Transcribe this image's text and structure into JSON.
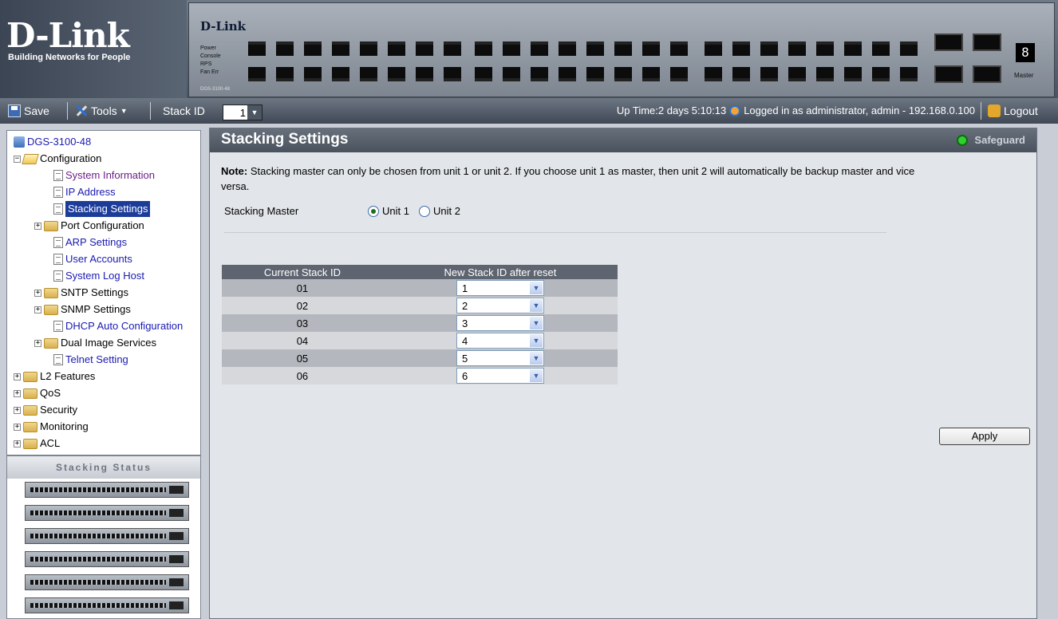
{
  "brand": {
    "logo": "D-Link",
    "tagline": "Building Networks for People",
    "device_brand": "D-Link",
    "device_leds": [
      "Power",
      "Console",
      "RPS",
      "Fan Err"
    ],
    "device_model": "DGS-3100-48",
    "segment_display": "8",
    "master_led": "Master"
  },
  "toolbar": {
    "save_label": "Save",
    "tools_label": "Tools",
    "stack_id_label": "Stack ID",
    "stack_id_value": "1",
    "uptime": "Up Time:2 days 5:10:13",
    "login_text": "Logged in as administrator, admin - 192.168.0.100",
    "logout_label": "Logout"
  },
  "tree": {
    "root": "DGS-3100-48",
    "configuration": "Configuration",
    "items": [
      {
        "label": "System Information"
      },
      {
        "label": "IP Address"
      },
      {
        "label": "Stacking Settings"
      },
      {
        "label": "Port Configuration"
      },
      {
        "label": "ARP Settings"
      },
      {
        "label": "User Accounts"
      },
      {
        "label": "System Log Host"
      },
      {
        "label": "SNTP Settings"
      },
      {
        "label": "SNMP Settings"
      },
      {
        "label": "DHCP Auto Configuration"
      },
      {
        "label": "Dual Image Services"
      },
      {
        "label": "Telnet Setting"
      }
    ],
    "top": [
      "L2 Features",
      "QoS",
      "Security",
      "Monitoring",
      "ACL"
    ]
  },
  "stacking_status": {
    "title": "Stacking Status"
  },
  "main": {
    "title": "Stacking Settings",
    "safeguard": "Safeguard",
    "note_bold": "Note:",
    "note_text": " Stacking master can only be chosen from unit 1 or unit 2. If you choose unit 1 as master, then unit 2 will automatically be backup master and vice versa.",
    "master_label": "Stacking Master",
    "unit1": "Unit 1",
    "unit2": "Unit 2",
    "table": {
      "col1": "Current Stack ID",
      "col2": "New Stack ID after reset",
      "rows": [
        {
          "current": "01",
          "new": "1"
        },
        {
          "current": "02",
          "new": "2"
        },
        {
          "current": "03",
          "new": "3"
        },
        {
          "current": "04",
          "new": "4"
        },
        {
          "current": "05",
          "new": "5"
        },
        {
          "current": "06",
          "new": "6"
        }
      ]
    },
    "apply_label": "Apply"
  }
}
